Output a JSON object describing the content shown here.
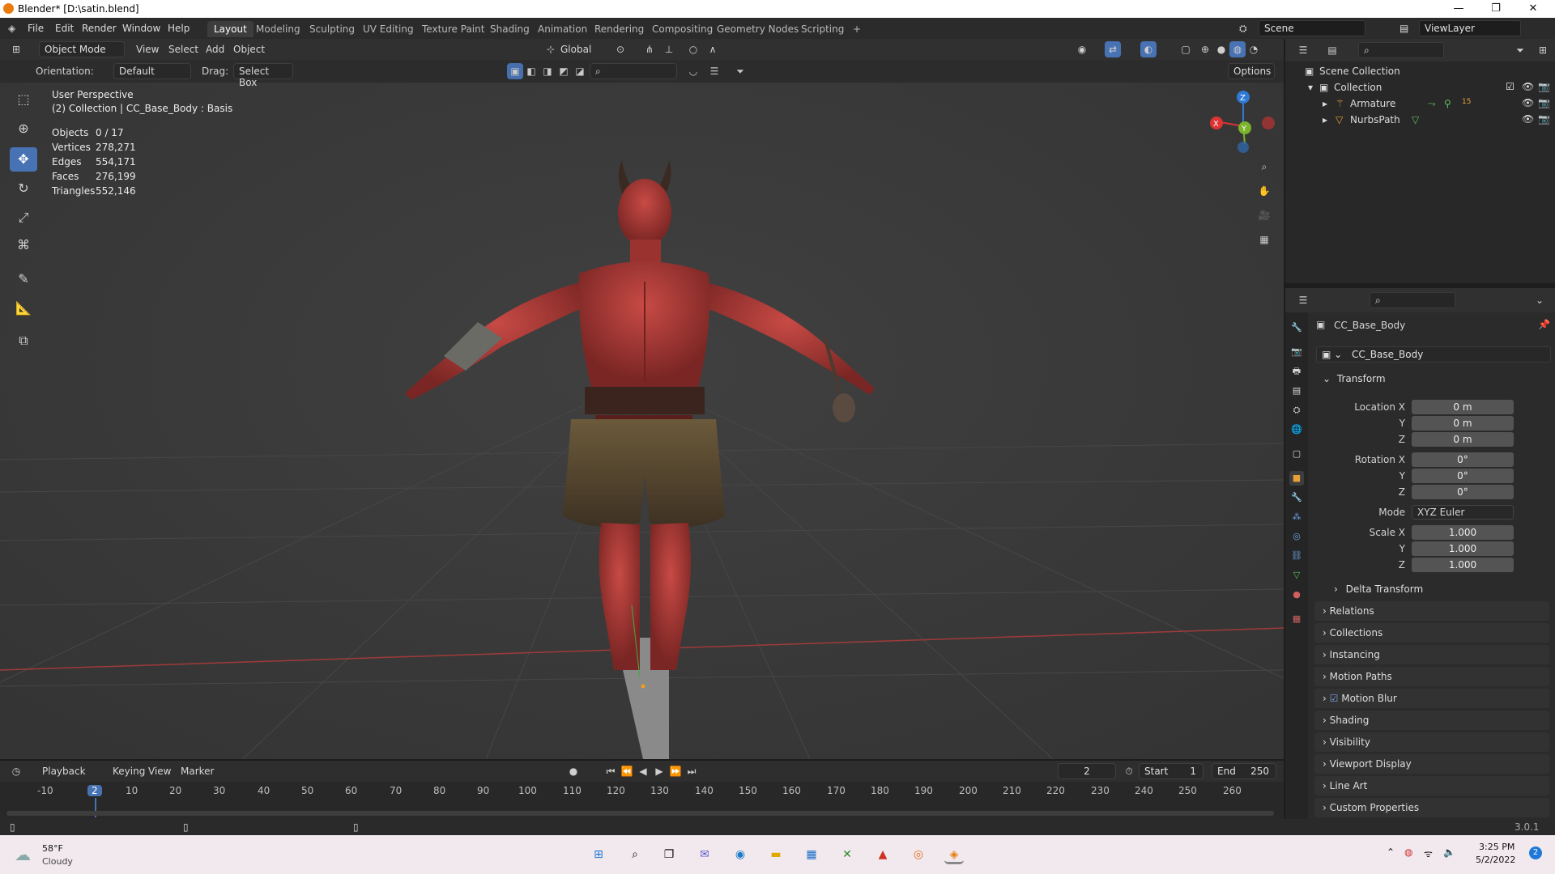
{
  "window": {
    "title": "Blender* [D:\\satin.blend]",
    "minimize": "—",
    "maximize": "❐",
    "close": "✕"
  },
  "menu": [
    "File",
    "Edit",
    "Render",
    "Window",
    "Help"
  ],
  "workspaces": [
    "Layout",
    "Modeling",
    "Sculpting",
    "UV Editing",
    "Texture Paint",
    "Shading",
    "Animation",
    "Rendering",
    "Compositing",
    "Geometry Nodes",
    "Scripting"
  ],
  "active_workspace": "Layout",
  "add_workspace": "+",
  "scene": {
    "label": "Scene",
    "view_layer": "ViewLayer"
  },
  "viewport_header": {
    "mode": "Object Mode",
    "menus": [
      "View",
      "Select",
      "Add",
      "Object"
    ],
    "transform_orientation": "Global",
    "options": "Options"
  },
  "tool_header": {
    "orientation_label": "Orientation:",
    "orientation_value": "Default",
    "drag_label": "Drag:",
    "drag_value": "Select Box"
  },
  "overlay": {
    "view_name": "User Perspective",
    "collection_line": "(2) Collection | CC_Base_Body : Basis",
    "stats": [
      {
        "label": "Objects",
        "value": "0 / 17"
      },
      {
        "label": "Vertices",
        "value": "278,271"
      },
      {
        "label": "Edges",
        "value": "554,171"
      },
      {
        "label": "Faces",
        "value": "276,199"
      },
      {
        "label": "Triangles",
        "value": "552,146"
      }
    ]
  },
  "gizmo": {
    "x": "X",
    "y": "Y",
    "z": "Z"
  },
  "timeline": {
    "menus": [
      "Playback",
      "Keying",
      "View",
      "Marker"
    ],
    "current_frame": "2",
    "start_label": "Start",
    "start": "1",
    "end_label": "End",
    "end": "250",
    "ticks": [
      "-10",
      "2",
      "10",
      "20",
      "30",
      "40",
      "50",
      "60",
      "70",
      "80",
      "90",
      "100",
      "110",
      "120",
      "130",
      "140",
      "150",
      "160",
      "170",
      "180",
      "190",
      "200",
      "210",
      "220",
      "230",
      "240",
      "250",
      "260"
    ]
  },
  "version": "3.0.1",
  "outliner": {
    "root": "Scene Collection",
    "collection": "Collection",
    "items": [
      "Armature",
      "NurbsPath"
    ],
    "badge": "15"
  },
  "properties": {
    "object_name": "CC_Base_Body",
    "object_data": "CC_Base_Body",
    "transform_title": "Transform",
    "location": {
      "label": "Location X",
      "x": "0 m",
      "y": "0 m",
      "z": "0 m"
    },
    "rotation": {
      "label": "Rotation X",
      "x": "0°",
      "y": "0°",
      "z": "0°"
    },
    "mode_label": "Mode",
    "mode_value": "XYZ Euler",
    "scale": {
      "label": "Scale X",
      "x": "1.000",
      "y": "1.000",
      "z": "1.000"
    },
    "axis_y": "Y",
    "axis_z": "Z",
    "delta_transform": "Delta Transform",
    "panels": [
      "Relations",
      "Collections",
      "Instancing",
      "Motion Paths",
      "Motion Blur",
      "Shading",
      "Visibility",
      "Viewport Display",
      "Line Art",
      "Custom Properties"
    ]
  },
  "taskbar": {
    "weather_temp": "58°F",
    "weather_desc": "Cloudy",
    "time": "3:25 PM",
    "date": "5/2/2022",
    "notifications": "2"
  }
}
